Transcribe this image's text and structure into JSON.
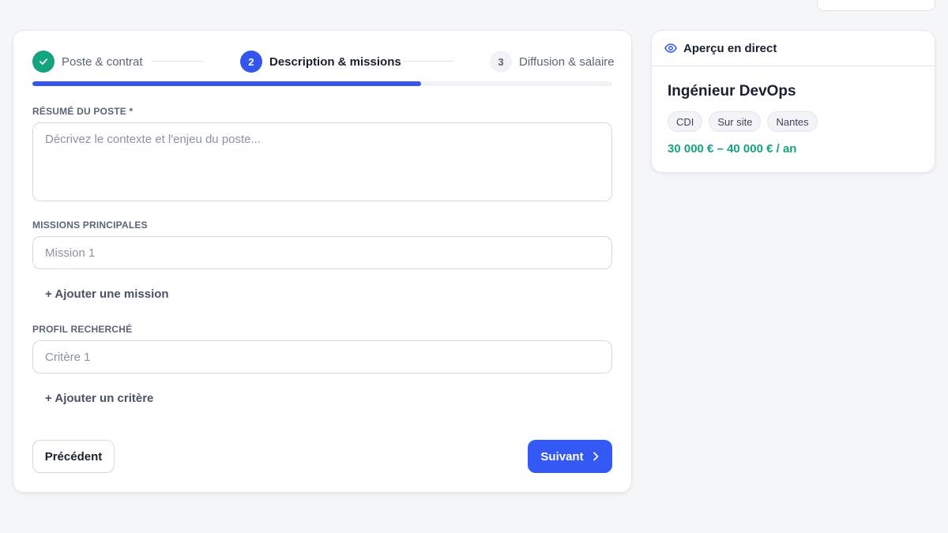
{
  "stepper": {
    "steps": [
      {
        "number": "",
        "label": "Poste & contrat",
        "state": "done"
      },
      {
        "number": "2",
        "label": "Description & missions",
        "state": "active"
      },
      {
        "number": "3",
        "label": "Diffusion & salaire",
        "state": "todo"
      }
    ],
    "progress_fraction": 0.67
  },
  "form": {
    "summary_label": "Résumé du poste *",
    "summary_placeholder": "Décrivez le contexte et l'enjeu du poste...",
    "missions_label": "Missions principales",
    "mission_placeholder": "Mission 1",
    "add_mission": "+ Ajouter une mission",
    "profile_label": "Profil recherché",
    "criterion_placeholder": "Critère 1",
    "add_criterion": "+ Ajouter un critère",
    "prev_label": "Précédent",
    "next_label": "Suivant"
  },
  "preview": {
    "header": "Aperçu en direct",
    "job_title": "Ingénieur DevOps",
    "tags": [
      "CDI",
      "Sur site",
      "Nantes"
    ],
    "salary": "30 000 € – 40 000 € / an"
  },
  "colors": {
    "accent": "#3355f0",
    "success": "#14a37f"
  }
}
